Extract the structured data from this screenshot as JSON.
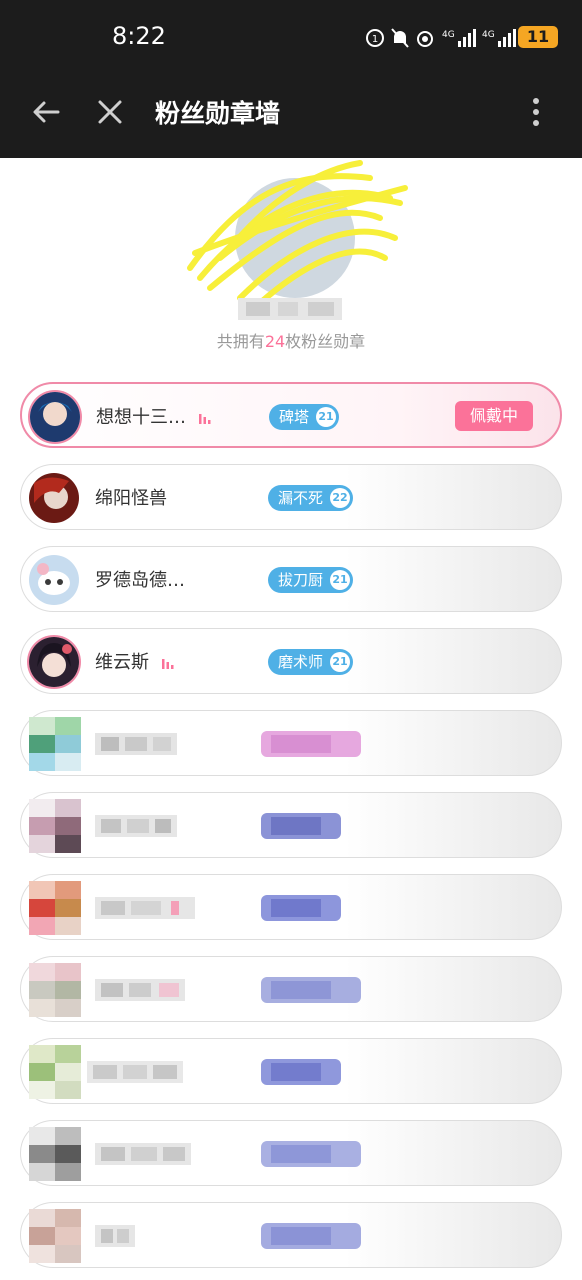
{
  "status_bar": {
    "time": "8:22",
    "battery": "11"
  },
  "app_bar": {
    "title": "粉丝勋章墙"
  },
  "profile": {
    "summary_prefix": "共拥有",
    "summary_count": "24",
    "summary_suffix": "枚粉丝勋章"
  },
  "medals": [
    {
      "name": "想想十三…",
      "badge": "碑塔",
      "level": "21",
      "live": true,
      "wearing": true,
      "wear_label": "佩戴中"
    },
    {
      "name": "绵阳怪兽",
      "badge": "漏不死",
      "level": "22",
      "live": false
    },
    {
      "name": "罗德岛德…",
      "badge": "拔刀厨",
      "level": "21",
      "live": false
    },
    {
      "name": "维云斯",
      "badge": "磨术师",
      "level": "21",
      "live": true
    }
  ],
  "colors": {
    "accent_pink": "#fb7299",
    "badge_blue": "#4fb0e6",
    "bar_dark": "#1c1c1c"
  }
}
